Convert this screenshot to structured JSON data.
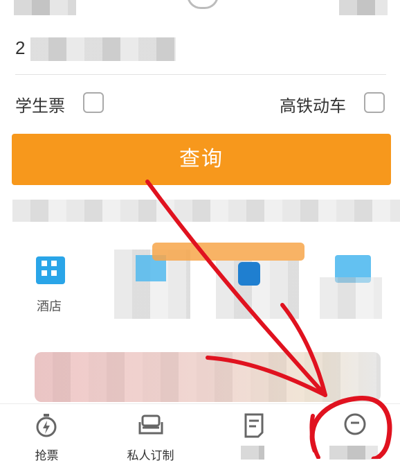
{
  "form": {
    "date_value_masked": "2█████████",
    "student_ticket_label": "学生票",
    "high_speed_label": "高铁动车",
    "search_label": "查询"
  },
  "quick_services": {
    "hotel_label": "酒店"
  },
  "bottom_nav": {
    "items": [
      {
        "label": "抢票",
        "icon": "stopwatch-icon"
      },
      {
        "label": "私人订制",
        "icon": "sofa-icon"
      },
      {
        "label": "订单",
        "icon": "order-list-icon"
      },
      {
        "label": "我的",
        "icon": "chat-bubble-icon"
      }
    ]
  },
  "colors": {
    "accent_orange": "#f7981c",
    "blue_icon": "#2aa5e8",
    "annotation_red": "#e0121f"
  }
}
